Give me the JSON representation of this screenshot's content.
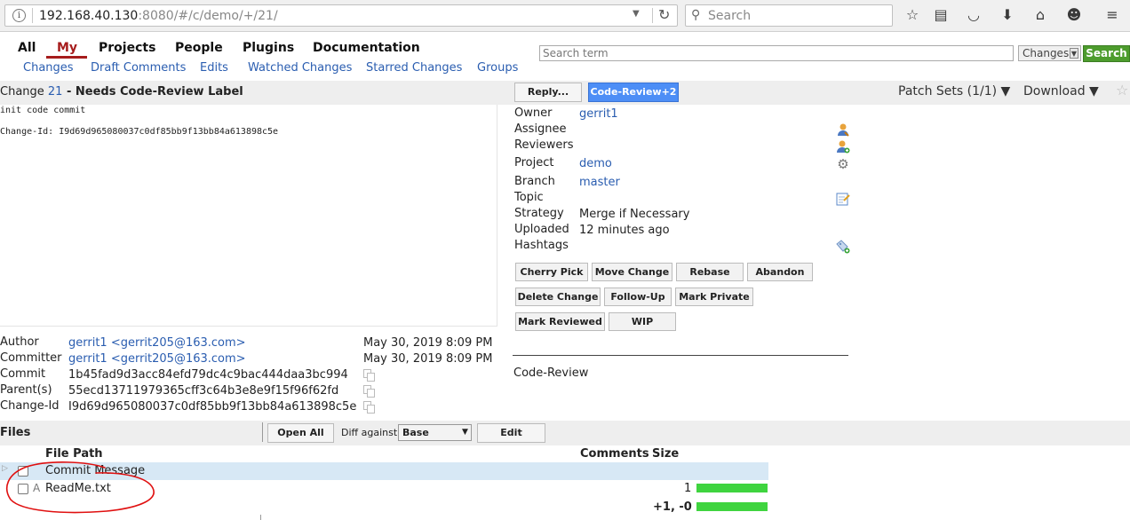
{
  "browser": {
    "url_host": "192.168.40.130",
    "url_rest": ":8080/#/c/demo/+/21/",
    "search_placeholder": "Search"
  },
  "topnav": {
    "items": [
      "All",
      "My",
      "Projects",
      "People",
      "Plugins",
      "Documentation"
    ],
    "selected": "My",
    "subitems": [
      "Changes",
      "Draft Comments",
      "Edits",
      "Watched Changes",
      "Starred Changes",
      "Groups"
    ]
  },
  "search": {
    "placeholder": "Search term",
    "scope": "Changes",
    "button": "Search"
  },
  "change": {
    "prefix": "Change ",
    "number": "21",
    "status": " - Needs Code-Review Label",
    "reply_label": "Reply...",
    "code_review_label": "Code-Review+2",
    "patch_sets": "Patch Sets (1/1) ▼",
    "download": "Download ▼"
  },
  "commit_message": {
    "line1": "init code commit",
    "line2": "Change-Id: I9d69d965080037c0df85bb9f13bb84a613898c5e"
  },
  "info": {
    "owner_label": "Owner",
    "owner": "gerrit1",
    "assignee_label": "Assignee",
    "reviewers_label": "Reviewers",
    "project_label": "Project",
    "project": "demo",
    "branch_label": "Branch",
    "branch": "master",
    "topic_label": "Topic",
    "strategy_label": "Strategy",
    "strategy": "Merge if Necessary",
    "uploaded_label": "Uploaded",
    "uploaded": "12 minutes ago",
    "hashtags_label": "Hashtags"
  },
  "actions": {
    "cherry_pick": "Cherry Pick",
    "move_change": "Move Change",
    "rebase": "Rebase",
    "abandon": "Abandon",
    "delete_change": "Delete Change",
    "follow_up": "Follow-Up",
    "mark_private": "Mark Private",
    "mark_reviewed": "Mark Reviewed",
    "wip": "WIP"
  },
  "labels": {
    "code_review": "Code-Review"
  },
  "commit_info": {
    "author_label": "Author",
    "author": "gerrit1 <gerrit205@163.com>",
    "author_date": "May 30, 2019 8:09 PM",
    "committer_label": "Committer",
    "committer": "gerrit1 <gerrit205@163.com>",
    "committer_date": "May 30, 2019 8:09 PM",
    "commit_label": "Commit",
    "commit": "1b45fad9d3acc84efd79dc4c9bac444daa3bc994",
    "parents_label": "Parent(s)",
    "parents": "55ecd13711979365cff3c64b3e8e9f15f96f62fd",
    "changeid_label": "Change-Id",
    "changeid": "I9d69d965080037c0df85bb9f13bb84a613898c5e"
  },
  "files": {
    "title": "Files",
    "open_all": "Open All",
    "diff_against_label": "Diff against:",
    "diff_against_value": "Base",
    "edit": "Edit",
    "col_path": "File Path",
    "col_comments": "Comments",
    "col_size": "Size",
    "rows": [
      {
        "status": "",
        "path": "Commit Message",
        "comments": ""
      },
      {
        "status": "A",
        "path": "ReadMe.txt",
        "comments": "1"
      }
    ],
    "total": "+1, -0"
  },
  "colors": {
    "accent_red": "#a61c1c",
    "link_blue": "#2a5db0",
    "primary_button": "#4d8ef6",
    "search_green": "#4d9c2d",
    "size_bar": "#3fd43f",
    "annotation": "#e01010"
  }
}
